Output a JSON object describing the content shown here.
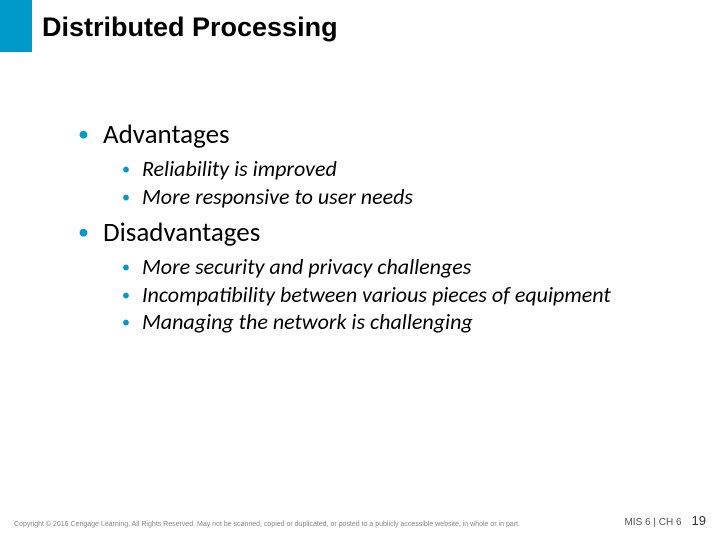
{
  "title": "Distributed Processing",
  "sections": [
    {
      "heading": "Advantages",
      "items": [
        "Reliability is improved",
        "More responsive to user needs"
      ]
    },
    {
      "heading": "Disadvantages",
      "items": [
        "More security and privacy challenges",
        "Incompatibility between various pieces of equipment",
        "Managing the network is challenging"
      ]
    }
  ],
  "footer": {
    "copyright": "Copyright © 2016 Cengage Learning. All Rights Reserved. May not be scanned, copied or duplicated, or posted to a publicly accessible website, in whole or in part.",
    "pager_label": "MIS 6 | CH 6",
    "page_number": "19"
  }
}
